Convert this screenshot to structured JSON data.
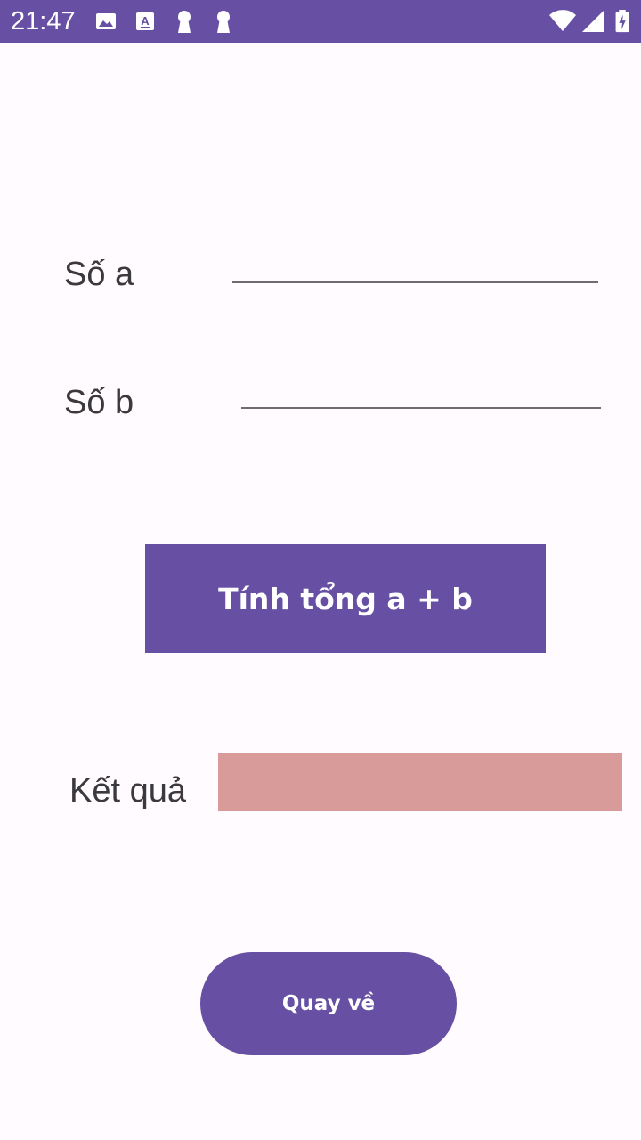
{
  "status_bar": {
    "time": "21:47",
    "icons": [
      "image-icon",
      "text-a-icon",
      "keyhole-icon",
      "keyhole-icon",
      "wifi-icon",
      "signal-icon",
      "battery-charging-icon"
    ],
    "background": "#6750a4"
  },
  "form": {
    "a_label": "Số a",
    "a_value": "",
    "b_label": "Số b",
    "b_value": "",
    "sum_button_label": "Tính tổng a + b",
    "result_label": "Kết quả",
    "result_value": "",
    "back_button_label": "Quay về"
  },
  "colors": {
    "primary": "#6750a4",
    "result_background": "#d99a9a",
    "page_background": "#fffbfe"
  }
}
